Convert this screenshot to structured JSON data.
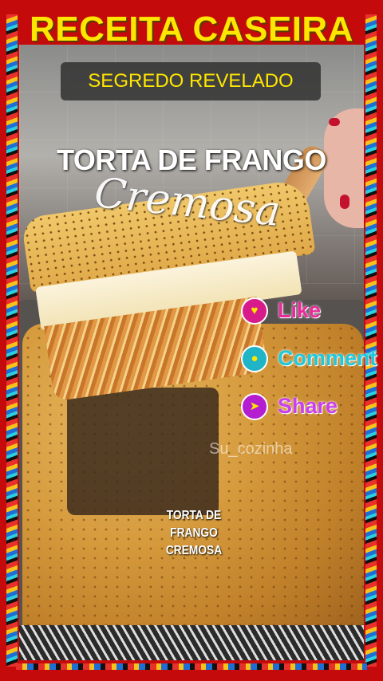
{
  "header": {
    "title": "RECEITA CASEIRA",
    "subtitle": "SEGREDO REVELADO"
  },
  "overlay": {
    "dish_title": "TORTA DE FRANGO",
    "dish_script": "Cremosa"
  },
  "social": [
    {
      "label": "Like",
      "icon": "heart-icon",
      "color": "#d81b8a"
    },
    {
      "label": "Comment",
      "icon": "search-bubble-icon",
      "color": "#1fb5c7"
    },
    {
      "label": "Share",
      "icon": "send-icon",
      "color": "#b51ed0"
    }
  ],
  "watermark": "Su_cozinha",
  "caption": {
    "line1": "TORTA DE FRANGO",
    "line2": "CREMOSA"
  },
  "colors": {
    "frame": "#c40a0a",
    "title": "#ffe600"
  }
}
